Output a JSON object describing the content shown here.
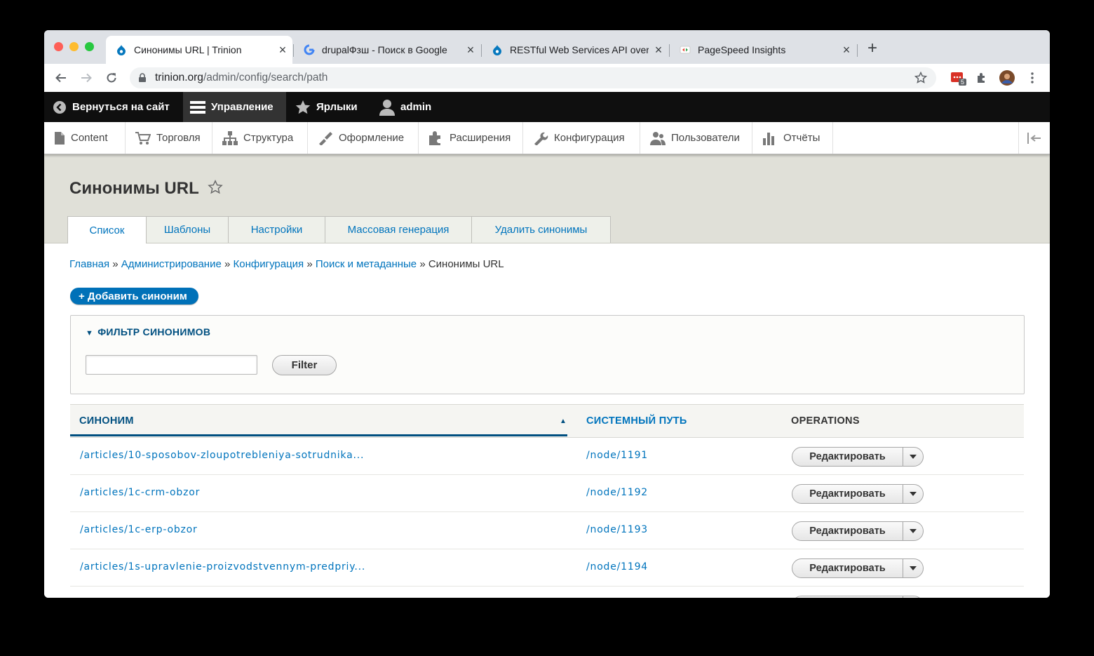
{
  "browser": {
    "tabs": [
      {
        "title": "Синонимы URL | Trinion",
        "active": true,
        "favicon": "drupal-icon"
      },
      {
        "title": "drupalФзш - Поиск в Google",
        "active": false,
        "favicon": "google-icon"
      },
      {
        "title": "RESTful Web Services API over",
        "active": false,
        "favicon": "drupal-icon"
      },
      {
        "title": "PageSpeed Insights",
        "active": false,
        "favicon": "pagespeed-icon"
      }
    ],
    "close_glyph": "×",
    "new_tab_glyph": "+",
    "address": {
      "domain": "trinion.org",
      "path": "/admin/config/search/path"
    },
    "extension_badge": "5"
  },
  "admin_toolbar": {
    "back_to_site": "Вернуться на сайт",
    "manage": "Управление",
    "shortcuts": "Ярлыки",
    "user": "admin"
  },
  "admin_menu": [
    {
      "label": "Content",
      "icon": "file-icon"
    },
    {
      "label": "Торговля",
      "icon": "cart-icon"
    },
    {
      "label": "Структура",
      "icon": "structure-icon"
    },
    {
      "label": "Оформление",
      "icon": "brush-icon"
    },
    {
      "label": "Расширения",
      "icon": "puzzle-icon"
    },
    {
      "label": "Конфигурация",
      "icon": "wrench-icon"
    },
    {
      "label": "Пользователи",
      "icon": "people-icon"
    },
    {
      "label": "Отчёты",
      "icon": "bar-chart-icon"
    }
  ],
  "page": {
    "title": "Синонимы URL",
    "tabs": [
      "Список",
      "Шаблоны",
      "Настройки",
      "Массовая генерация",
      "Удалить синонимы"
    ],
    "active_tab": 0,
    "breadcrumb": [
      "Главная",
      "Администрирование",
      "Конфигурация",
      "Поиск и метаданные"
    ],
    "breadcrumb_current": "Синонимы URL",
    "breadcrumb_sep": "»",
    "add_button": "+ Добавить синоним"
  },
  "filter": {
    "legend": "ФИЛЬТР СИНОНИМОВ",
    "collapse_glyph": "▼",
    "input_value": "",
    "button": "Filter"
  },
  "table": {
    "headers": {
      "alias": "СИНОНИМ",
      "system": "СИСТЕМНЫЙ ПУТЬ",
      "operations": "OPERATIONS"
    },
    "sort_glyph": "▲",
    "rows": [
      {
        "alias": "/articles/10-sposobov-zloupotrebleniya-sotrudnika...",
        "system": "/node/1191",
        "op": "Редактировать"
      },
      {
        "alias": "/articles/1c-crm-obzor",
        "system": "/node/1192",
        "op": "Редактировать"
      },
      {
        "alias": "/articles/1c-erp-obzor",
        "system": "/node/1193",
        "op": "Редактировать"
      },
      {
        "alias": "/articles/1s-upravlenie-proizvodstvennym-predpriy...",
        "system": "/node/1194",
        "op": "Редактировать"
      }
    ]
  }
}
